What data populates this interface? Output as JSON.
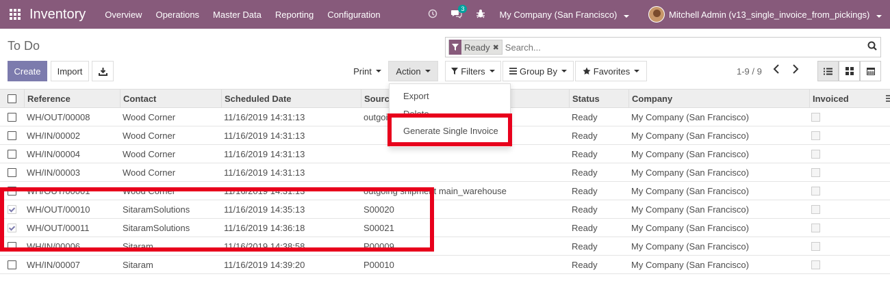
{
  "navbar": {
    "app_title": "Inventory",
    "menu": [
      "Overview",
      "Operations",
      "Master Data",
      "Reporting",
      "Configuration"
    ],
    "chat_badge": "3",
    "company": "My Company (San Francisco)",
    "user": "Mitchell Admin (v13_single_invoice_from_pickings)"
  },
  "page": {
    "breadcrumb": "To Do"
  },
  "search": {
    "facet_value": "Ready",
    "placeholder": "Search..."
  },
  "buttons": {
    "create": "Create",
    "import": "Import",
    "print": "Print",
    "action": "Action",
    "filters": "Filters",
    "group_by": "Group By",
    "favorites": "Favorites"
  },
  "pager": "1-9 / 9",
  "table": {
    "headers": [
      "Reference",
      "Contact",
      "Scheduled Date",
      "Source Document",
      "Status",
      "Company",
      "Invoiced"
    ],
    "rows": [
      {
        "ref": "WH/OUT/00008",
        "contact": "Wood Corner",
        "date": "11/16/2019 14:31:13",
        "source": "outgoing shipment main_warehouse",
        "status": "Ready",
        "company": "My Company (San Francisco)",
        "checked": false
      },
      {
        "ref": "WH/IN/00002",
        "contact": "Wood Corner",
        "date": "11/16/2019 14:31:13",
        "source": "",
        "status": "Ready",
        "company": "My Company (San Francisco)",
        "checked": false
      },
      {
        "ref": "WH/IN/00004",
        "contact": "Wood Corner",
        "date": "11/16/2019 14:31:13",
        "source": "",
        "status": "Ready",
        "company": "My Company (San Francisco)",
        "checked": false
      },
      {
        "ref": "WH/IN/00003",
        "contact": "Wood Corner",
        "date": "11/16/2019 14:31:13",
        "source": "",
        "status": "Ready",
        "company": "My Company (San Francisco)",
        "checked": false
      },
      {
        "ref": "WH/OUT/00001",
        "contact": "Wood Corner",
        "date": "11/16/2019 14:31:13",
        "source": "outgoing shipment main_warehouse",
        "status": "Ready",
        "company": "My Company (San Francisco)",
        "checked": false
      },
      {
        "ref": "WH/OUT/00010",
        "contact": "SitaramSolutions",
        "date": "11/16/2019 14:35:13",
        "source": "S00020",
        "status": "Ready",
        "company": "My Company (San Francisco)",
        "checked": true
      },
      {
        "ref": "WH/OUT/00011",
        "contact": "SitaramSolutions",
        "date": "11/16/2019 14:36:18",
        "source": "S00021",
        "status": "Ready",
        "company": "My Company (San Francisco)",
        "checked": true
      },
      {
        "ref": "WH/IN/00006",
        "contact": "Sitaram",
        "date": "11/16/2019 14:38:58",
        "source": "P00009",
        "status": "Ready",
        "company": "My Company (San Francisco)",
        "checked": false
      },
      {
        "ref": "WH/IN/00007",
        "contact": "Sitaram",
        "date": "11/16/2019 14:39:20",
        "source": "P00010",
        "status": "Ready",
        "company": "My Company (San Francisco)",
        "checked": false
      }
    ]
  },
  "action_menu": [
    "Export",
    "Delete",
    "Generate Single Invoice"
  ],
  "colors": {
    "brand": "#875a7b",
    "primary_button": "#7c7bad",
    "highlight": "#e8001c"
  }
}
